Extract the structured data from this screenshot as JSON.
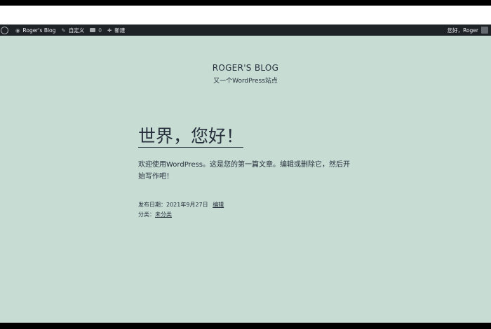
{
  "admin_bar": {
    "site_name": "Roger's Blog",
    "customize_label": "自定义",
    "comments_count": "0",
    "new_label": "新建",
    "greeting": "您好，Roger"
  },
  "site": {
    "title": "ROGER'S BLOG",
    "description": "又一个WordPress站点"
  },
  "post": {
    "title": "世界，您好！",
    "body": "欢迎使用WordPress。这是您的第一篇文章。编辑或删除它，然后开始写作吧！",
    "published_label": "发布日期：",
    "published_date": "2021年9月27日",
    "edit_label": "编辑",
    "category_label": "分类：",
    "category_value": "未分类"
  },
  "colors": {
    "background": "#c7ddd4",
    "admin_bar": "#1d2327",
    "text": "#28303d"
  }
}
